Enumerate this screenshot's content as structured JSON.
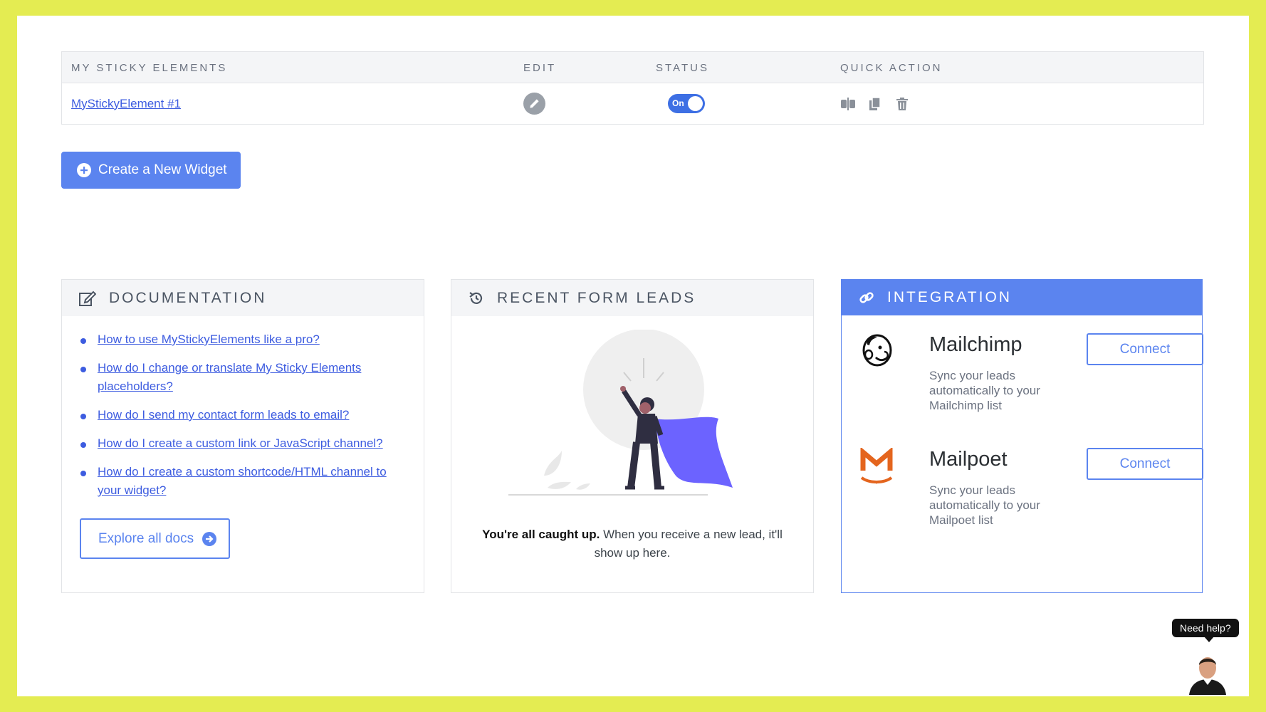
{
  "table": {
    "headers": {
      "elements": "MY STICKY ELEMENTS",
      "edit": "EDIT",
      "status": "STATUS",
      "quick_action": "QUICK ACTION"
    },
    "rows": [
      {
        "name": "MyStickyElement #1",
        "status_label": "On",
        "status_on": true
      }
    ],
    "quick_action_icons": [
      "split-icon",
      "duplicate-icon",
      "trash-icon"
    ]
  },
  "create_button": {
    "label": "Create a New Widget",
    "icon": "plus-circle-icon"
  },
  "documentation": {
    "title": "DOCUMENTATION",
    "links": [
      "How to use MyStickyElements like a pro?",
      "How do I change or translate My Sticky Elements placeholders?",
      "How do I send my contact form leads to email?",
      "How do I create a custom link or JavaScript channel?",
      "How do I create a custom shortcode/HTML channel to your widget?"
    ],
    "explore_label": "Explore all docs"
  },
  "leads": {
    "title": "RECENT FORM LEADS",
    "message_strong": "You're all caught up.",
    "message_rest": " When you receive a new lead, it'll show up here."
  },
  "integration": {
    "title": "INTEGRATION",
    "items": [
      {
        "name": "Mailchimp",
        "desc": "Sync your leads automatically to your Mailchimp list",
        "button": "Connect"
      },
      {
        "name": "Mailpoet",
        "desc": "Sync your leads automatically to your Mailpoet list",
        "button": "Connect"
      }
    ]
  },
  "help": {
    "label": "Need help?"
  },
  "colors": {
    "frame": "#e4ec52",
    "accent": "#5b84ef",
    "link": "#3d5ce0",
    "mailpoet": "#e4651e"
  }
}
